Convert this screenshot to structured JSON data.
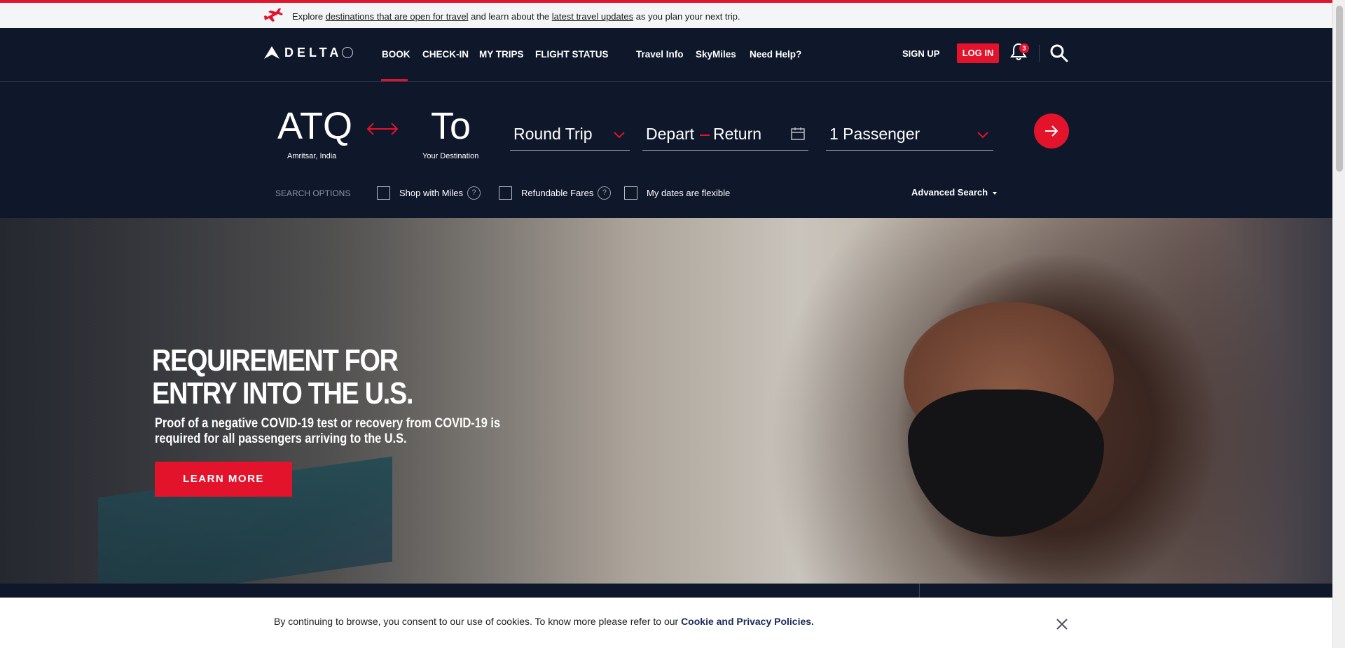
{
  "alert": {
    "icon": "plane-icon",
    "prefix": "Explore ",
    "link1": "destinations that are open for travel",
    "middle": " and learn about the ",
    "link2": "latest travel updates",
    "suffix": " as you plan your next trip."
  },
  "brand": {
    "name": "DELTA",
    "accent": "#e3132c",
    "navy": "#0f172a"
  },
  "nav": {
    "primary": [
      "BOOK",
      "CHECK-IN",
      "MY TRIPS",
      "FLIGHT STATUS"
    ],
    "secondary": [
      "Travel Info",
      "SkyMiles",
      "Need Help?"
    ],
    "active": "BOOK",
    "signup": "SIGN UP",
    "login": "LOG IN",
    "notifications": "3"
  },
  "booking": {
    "from_code": "ATQ",
    "from_city": "Amritsar, India",
    "to_code": "To",
    "to_sub": "Your Destination",
    "trip_type": "Round Trip",
    "depart": "Depart",
    "return": "Return",
    "passengers": "1 Passenger",
    "search_options": "SEARCH OPTIONS",
    "options": [
      "Shop with Miles",
      "Refundable Fares",
      "My dates are flexible"
    ],
    "help_mark": "?",
    "advanced": "Advanced Search"
  },
  "hero": {
    "title_line1": "REQUIREMENT FOR",
    "title_line2": "ENTRY INTO THE U.S.",
    "subtitle": "Proof of a negative COVID-19 test or recovery from COVID-19 is required for all passengers arriving to the U.S.",
    "cta": "LEARN MORE"
  },
  "cookie": {
    "text": "By continuing to browse, you consent to our use of cookies. To know more please refer to our ",
    "link": "Cookie and Privacy Policies."
  }
}
